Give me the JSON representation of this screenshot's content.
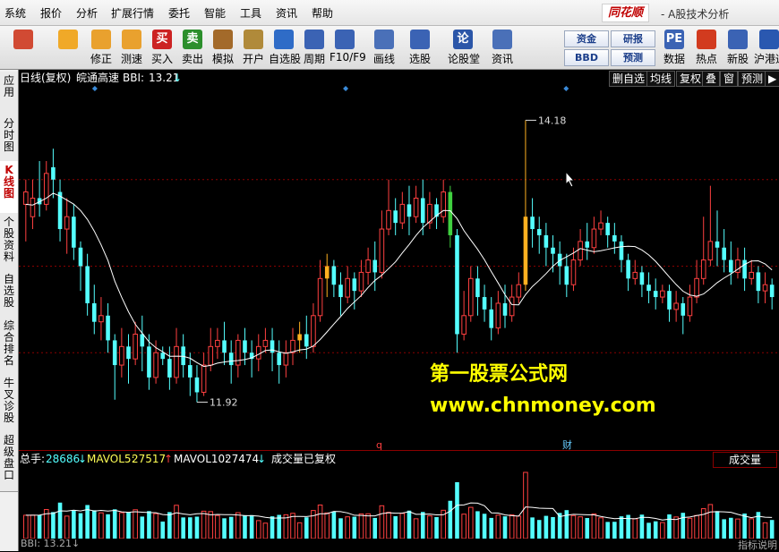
{
  "menu": {
    "items": [
      "系统",
      "报价",
      "分析",
      "扩展行情",
      "委托",
      "智能",
      "工具",
      "资讯",
      "帮助"
    ],
    "brand": "同花顺",
    "brand_subtitle": "- A股技术分析"
  },
  "toolbar": {
    "buttons": [
      {
        "label": "",
        "icon": "grid-icon",
        "color": "#d14a33"
      },
      {
        "label": "",
        "icon": "back-arrow-icon",
        "color": "#f0a928"
      },
      {
        "label": "修正",
        "icon": "up-down-icon",
        "color": "#e9a12e"
      },
      {
        "label": "测速",
        "icon": "speed-icon",
        "color": "#e9a12e"
      },
      {
        "label": "买入",
        "icon": "buy-icon",
        "color": "#cc2222",
        "text": "买"
      },
      {
        "label": "卖出",
        "icon": "sell-icon",
        "color": "#2c8f2c",
        "text": "卖"
      },
      {
        "label": "模拟",
        "icon": "hammer-icon",
        "color": "#a36a2a"
      },
      {
        "label": "开户",
        "icon": "lock-icon",
        "color": "#b08a3a"
      },
      {
        "label": "自选股",
        "icon": "star-icon",
        "color": "#2f6cc7"
      },
      {
        "label": "周期",
        "icon": "clock-icon",
        "color": "#3b63b4"
      },
      {
        "label": "F10/F9",
        "icon": "f10-icon",
        "color": "#3b63b4"
      },
      {
        "label": "画线",
        "icon": "pen-icon",
        "color": "#4a70b8"
      },
      {
        "label": "选股",
        "icon": "chart-icon",
        "color": "#3b63b4"
      },
      {
        "label": "论股堂",
        "icon": "forum-icon",
        "color": "#2b56a8",
        "text": "论"
      },
      {
        "label": "资讯",
        "icon": "news-icon",
        "color": "#4a70b8"
      },
      {
        "label": "数据",
        "icon": "data-icon",
        "color": "#3b63b4",
        "text": "PE"
      },
      {
        "label": "热点",
        "icon": "hot-icon",
        "color": "#d23b1f"
      },
      {
        "label": "新股",
        "icon": "ipo-icon",
        "color": "#3b63b4"
      },
      {
        "label": "沪港通",
        "icon": "hk-icon",
        "color": "#2a58b0"
      }
    ],
    "text_buttons": [
      {
        "label": "资金"
      },
      {
        "label": "研报"
      },
      {
        "label": "BBD"
      },
      {
        "label": "预测"
      }
    ]
  },
  "sidebar": {
    "tabs": [
      "应用",
      "分时图",
      "K线图",
      "个股资料",
      "自选股",
      "综合排名",
      "牛叉诊股",
      "超级盘口"
    ],
    "active": "K线图"
  },
  "chart_header": {
    "period": "日线(复权)",
    "stock": "皖通高速",
    "indicator_name": "BBI:",
    "indicator_value": "13.21",
    "arrow": "↓",
    "right_buttons": [
      "删自选",
      "均线",
      "复权",
      "叠",
      "窗",
      "预测",
      "▶"
    ]
  },
  "volume_header": {
    "total_label": "总手:",
    "total_value": "28686",
    "total_arrow": "↓",
    "mavol5_label": "MAVOL5:",
    "mavol5_value": "27517",
    "mavol5_arrow": "↑",
    "mavol10_label": "MAVOL10:",
    "mavol10_value": "27474",
    "mavol10_arrow": "↓",
    "note": "成交量已复权",
    "panel_name": "成交量"
  },
  "footer": {
    "indicator": "BBI: 13.21↓",
    "right": "指标说明"
  },
  "watermark": {
    "line1": "第一股票公式网",
    "line2": "www.chnmoney.com"
  },
  "colors": {
    "up": "#ff4040",
    "down": "#54ffff",
    "line": "#ffffff",
    "highlight_orange": "#ffb020",
    "highlight_green": "#40d040",
    "watermark": "#ffff00"
  },
  "chart_data": {
    "type": "candlestick",
    "title": "皖通高速",
    "annotations": [
      {
        "text": "14.18",
        "kind": "high"
      },
      {
        "text": "11.92",
        "kind": "low"
      }
    ],
    "markers": [
      {
        "text": "q",
        "color": "#ff4040"
      },
      {
        "text": "财",
        "color": "#66ccff"
      }
    ],
    "ylim": [
      11.6,
      14.4
    ],
    "candles": [
      [
        13.5,
        13.6,
        13.2,
        13.7
      ],
      [
        13.4,
        13.55,
        13.3,
        13.7
      ],
      [
        13.55,
        13.5,
        13.4,
        13.85
      ],
      [
        13.5,
        13.75,
        13.45,
        13.85
      ],
      [
        13.8,
        13.7,
        13.55,
        13.95
      ],
      [
        13.6,
        13.3,
        13.2,
        13.7
      ],
      [
        13.3,
        13.4,
        13.1,
        13.55
      ],
      [
        13.4,
        13.15,
        13.05,
        13.5
      ],
      [
        13.15,
        13.0,
        12.8,
        13.2
      ],
      [
        13.0,
        12.7,
        12.6,
        13.1
      ],
      [
        12.7,
        12.55,
        12.45,
        12.85
      ],
      [
        12.55,
        12.6,
        12.4,
        12.75
      ],
      [
        12.6,
        12.4,
        12.3,
        12.7
      ],
      [
        12.4,
        12.2,
        11.92,
        12.45
      ],
      [
        12.2,
        12.35,
        12.1,
        12.5
      ],
      [
        12.35,
        12.25,
        12.05,
        12.45
      ],
      [
        12.25,
        12.45,
        12.2,
        12.55
      ],
      [
        12.45,
        12.35,
        12.15,
        12.6
      ],
      [
        12.35,
        12.1,
        12.0,
        12.45
      ],
      [
        12.1,
        12.3,
        12.05,
        12.4
      ],
      [
        12.3,
        12.25,
        12.2,
        12.35
      ],
      [
        12.25,
        12.1,
        12.0,
        12.35
      ],
      [
        12.1,
        12.35,
        12.05,
        12.5
      ],
      [
        12.35,
        12.2,
        12.1,
        12.45
      ],
      [
        12.2,
        12.1,
        11.95,
        12.3
      ],
      [
        12.1,
        11.98,
        11.9,
        12.2
      ],
      [
        11.98,
        12.2,
        11.95,
        12.3
      ],
      [
        12.2,
        12.35,
        12.15,
        12.5
      ],
      [
        12.35,
        12.4,
        12.25,
        12.5
      ],
      [
        12.4,
        12.3,
        12.2,
        12.55
      ],
      [
        12.3,
        12.2,
        12.05,
        12.4
      ],
      [
        12.2,
        12.4,
        12.1,
        12.45
      ],
      [
        12.4,
        12.3,
        12.2,
        12.5
      ],
      [
        12.3,
        12.25,
        12.1,
        12.4
      ],
      [
        12.25,
        12.35,
        12.15,
        12.45
      ],
      [
        12.35,
        12.4,
        12.3,
        12.5
      ],
      [
        12.4,
        12.3,
        12.15,
        12.5
      ],
      [
        12.3,
        12.2,
        12.05,
        12.4
      ],
      [
        12.2,
        12.3,
        12.1,
        12.4
      ],
      [
        12.3,
        12.4,
        12.2,
        12.5
      ],
      [
        12.4,
        12.45,
        12.3,
        12.55
      ],
      [
        12.45,
        12.35,
        12.25,
        12.6
      ],
      [
        12.35,
        12.6,
        12.3,
        12.7
      ],
      [
        12.6,
        12.9,
        12.55,
        13.05
      ],
      [
        12.9,
        13.0,
        12.75,
        13.1
      ],
      [
        13.0,
        12.85,
        12.75,
        13.05
      ],
      [
        12.85,
        12.75,
        12.6,
        12.95
      ],
      [
        12.75,
        12.9,
        12.7,
        13.0
      ],
      [
        12.9,
        12.8,
        12.65,
        12.95
      ],
      [
        12.8,
        12.95,
        12.75,
        13.05
      ],
      [
        12.95,
        13.05,
        12.85,
        13.15
      ],
      [
        13.05,
        12.95,
        12.8,
        13.2
      ],
      [
        12.95,
        13.3,
        12.9,
        13.45
      ],
      [
        13.3,
        13.45,
        13.25,
        13.7
      ],
      [
        13.45,
        13.35,
        13.25,
        13.55
      ],
      [
        13.35,
        13.5,
        13.3,
        13.6
      ],
      [
        13.5,
        13.4,
        13.25,
        13.65
      ],
      [
        13.4,
        13.55,
        13.35,
        13.65
      ],
      [
        13.55,
        13.35,
        13.25,
        13.7
      ],
      [
        13.35,
        13.5,
        13.3,
        13.6
      ],
      [
        13.5,
        13.4,
        13.3,
        13.55
      ],
      [
        13.4,
        13.6,
        13.35,
        13.7
      ],
      [
        13.6,
        13.25,
        13.15,
        13.65
      ],
      [
        13.25,
        12.45,
        12.3,
        13.3
      ],
      [
        12.45,
        12.6,
        12.4,
        12.8
      ],
      [
        12.6,
        12.9,
        12.55,
        13.0
      ],
      [
        12.9,
        12.75,
        12.6,
        13.0
      ],
      [
        12.75,
        12.65,
        12.55,
        12.85
      ],
      [
        12.65,
        12.5,
        12.4,
        12.75
      ],
      [
        12.5,
        12.7,
        12.45,
        12.8
      ],
      [
        12.7,
        12.6,
        12.5,
        12.85
      ],
      [
        12.6,
        12.75,
        12.55,
        12.85
      ],
      [
        12.75,
        12.85,
        12.7,
        12.95
      ],
      [
        12.85,
        13.4,
        12.8,
        14.18
      ],
      [
        13.4,
        13.3,
        13.15,
        13.55
      ],
      [
        13.3,
        13.25,
        13.1,
        13.4
      ],
      [
        13.25,
        13.15,
        13.0,
        13.35
      ],
      [
        13.15,
        13.1,
        12.95,
        13.25
      ],
      [
        13.1,
        13.0,
        12.85,
        13.2
      ],
      [
        13.0,
        12.85,
        12.75,
        13.1
      ],
      [
        12.85,
        13.05,
        12.8,
        13.15
      ],
      [
        13.05,
        13.2,
        13.0,
        13.3
      ],
      [
        13.2,
        13.15,
        13.05,
        13.35
      ],
      [
        13.15,
        13.3,
        13.1,
        13.4
      ],
      [
        13.3,
        13.35,
        13.25,
        13.45
      ],
      [
        13.35,
        13.25,
        13.15,
        13.4
      ],
      [
        13.25,
        13.2,
        13.1,
        13.35
      ],
      [
        13.2,
        13.05,
        12.95,
        13.25
      ],
      [
        13.05,
        12.9,
        12.8,
        13.1
      ],
      [
        12.9,
        12.95,
        12.85,
        13.05
      ],
      [
        12.95,
        12.85,
        12.75,
        13.0
      ],
      [
        12.85,
        12.8,
        12.7,
        12.95
      ],
      [
        12.8,
        12.75,
        12.65,
        12.9
      ],
      [
        12.75,
        12.8,
        12.7,
        12.85
      ],
      [
        12.8,
        12.65,
        12.55,
        12.85
      ],
      [
        12.65,
        12.7,
        12.55,
        12.8
      ],
      [
        12.7,
        12.6,
        12.45,
        12.75
      ],
      [
        12.6,
        12.75,
        12.55,
        12.85
      ],
      [
        12.75,
        12.9,
        12.7,
        13.05
      ],
      [
        12.9,
        13.05,
        12.85,
        13.4
      ],
      [
        13.05,
        13.2,
        13.0,
        13.65
      ],
      [
        13.2,
        13.15,
        13.0,
        13.45
      ],
      [
        13.15,
        13.05,
        12.95,
        13.3
      ],
      [
        13.05,
        12.95,
        12.85,
        13.2
      ],
      [
        12.95,
        13.05,
        12.9,
        13.15
      ],
      [
        13.05,
        12.9,
        12.8,
        13.15
      ],
      [
        12.9,
        12.95,
        12.85,
        13.05
      ],
      [
        12.95,
        12.8,
        12.7,
        13.0
      ],
      [
        12.8,
        12.85,
        12.7,
        12.95
      ],
      [
        12.85,
        12.75,
        12.65,
        12.9
      ]
    ]
  }
}
